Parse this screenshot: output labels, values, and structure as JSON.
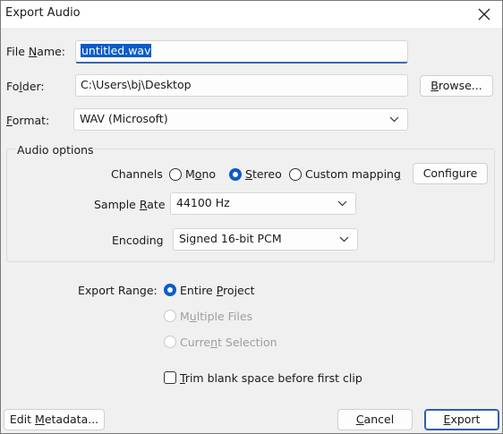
{
  "window": {
    "title": "Export Audio",
    "close_icon": "close-icon"
  },
  "file_name": {
    "label_pre": "File ",
    "label_acc": "N",
    "label_post": "ame:",
    "value": "untitled.wav"
  },
  "folder": {
    "label_pre": "Fo",
    "label_acc": "l",
    "label_post": "der:",
    "value": "C:\\Users\\bj\\Desktop",
    "browse_acc": "B",
    "browse_post": "rowse..."
  },
  "format": {
    "label_pre": "",
    "label_acc": "F",
    "label_post": "ormat:",
    "value": "WAV (Microsoft)"
  },
  "audio_options": {
    "title": "Audio options",
    "channels_label": "Channels",
    "channel_mono_pre": "M",
    "channel_mono_acc": "o",
    "channel_mono_post": "no",
    "channel_stereo_pre": "",
    "channel_stereo_acc": "S",
    "channel_stereo_post": "tereo",
    "channel_custom_pre": "Custom mappin",
    "channel_custom_acc": "g",
    "channel_custom_post": "",
    "channel_selected": "stereo",
    "configure_label": "Configure",
    "sample_rate_pre": "Sample ",
    "sample_rate_acc": "R",
    "sample_rate_post": "ate",
    "sample_rate_value": "44100 Hz",
    "encoding_label": "Encoding",
    "encoding_value": "Signed 16-bit PCM"
  },
  "export_range": {
    "label": "Export Range:",
    "entire_pre": "Entire ",
    "entire_acc": "P",
    "entire_post": "roject",
    "multiple_pre": "M",
    "multiple_acc": "u",
    "multiple_post": "ltiple Files",
    "current_pre": "Curre",
    "current_acc": "n",
    "current_post": "t Selection",
    "selected": "entire_project"
  },
  "trim": {
    "label_pre": "",
    "label_acc": "T",
    "label_post": "rim blank space before first clip",
    "checked": false
  },
  "footer": {
    "edit_meta_pre": "Edit ",
    "edit_meta_acc": "M",
    "edit_meta_post": "etadata...",
    "cancel_pre": "",
    "cancel_acc": "C",
    "cancel_post": "ancel",
    "export_pre": "",
    "export_acc": "E",
    "export_post": "xport"
  },
  "colors": {
    "accent": "#0b5cc6",
    "focus_border": "#3b66b9",
    "disabled_text": "#9e9e9e"
  }
}
